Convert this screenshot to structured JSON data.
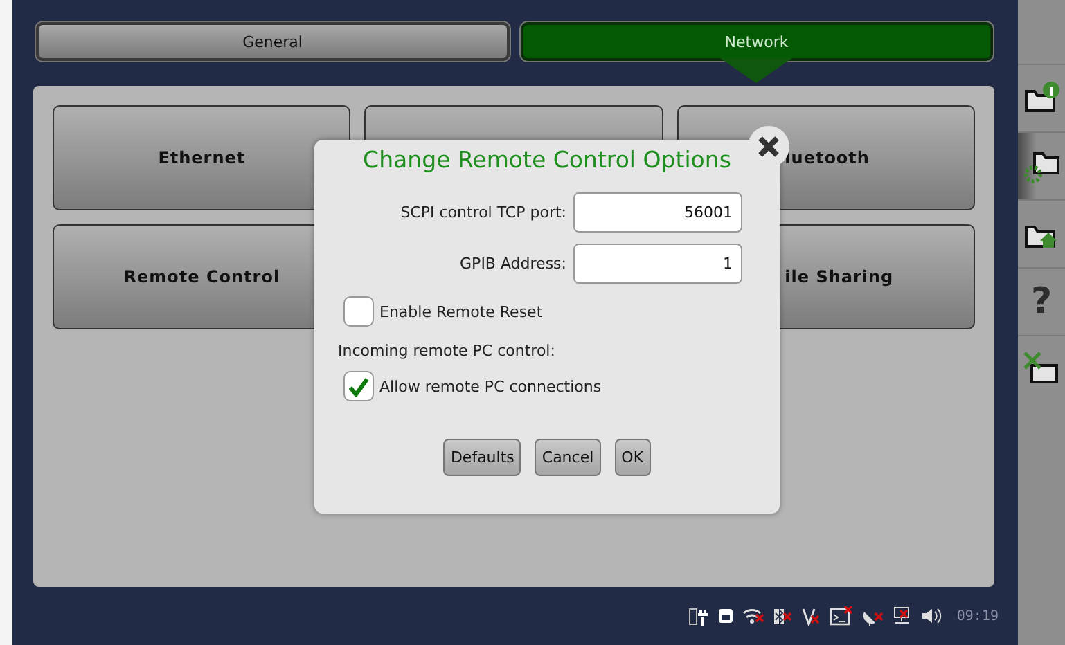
{
  "tabs": [
    {
      "label": "General",
      "selected": false
    },
    {
      "label": "Network",
      "selected": true
    }
  ],
  "tile_rows": [
    [
      {
        "kind": "label",
        "label": "Ethernet"
      },
      {
        "kind": "blank"
      },
      {
        "kind": "clipped",
        "label": "luetooth"
      }
    ],
    [
      {
        "kind": "label",
        "label": "Remote Control"
      },
      {
        "kind": "clipped",
        "label": "ile Sharing"
      }
    ]
  ],
  "dialog": {
    "title": "Change Remote Control Options",
    "fields": [
      {
        "label": "SCPI control TCP port:",
        "value": "56001"
      },
      {
        "label": "GPIB Address:",
        "value": "1"
      }
    ],
    "reset_option": {
      "label": "Enable Remote Reset",
      "checked": false
    },
    "section_label": "Incoming remote PC control:",
    "remote_option": {
      "label": "Allow remote PC connections",
      "checked": true
    },
    "buttons": [
      "Defaults",
      "Cancel",
      "OK"
    ]
  },
  "sidebar": [
    {
      "kind": "info",
      "selected": false
    },
    {
      "kind": "gear",
      "selected": true
    },
    {
      "kind": "home",
      "selected": false
    },
    {
      "kind": "help",
      "glyph": "?",
      "selected": false
    },
    {
      "kind": "tools",
      "selected": false
    }
  ],
  "status_bar": {
    "time": "09:19"
  }
}
